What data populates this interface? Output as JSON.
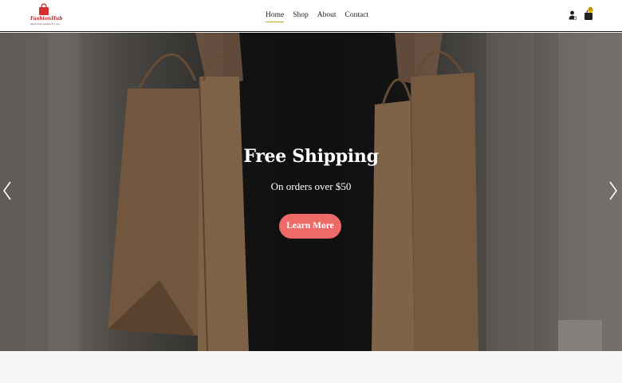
{
  "header": {
    "logo": {
      "name": "FashionHub",
      "tagline": "Style that speaks for you"
    },
    "nav": [
      {
        "label": "Home",
        "active": true
      },
      {
        "label": "Shop",
        "active": false
      },
      {
        "label": "About",
        "active": false
      },
      {
        "label": "Contact",
        "active": false
      }
    ],
    "icons": {
      "user": "user-icon",
      "cart": "shopping-bag-icon"
    },
    "cart_count": "0"
  },
  "hero": {
    "title": "Free Shipping",
    "subtitle": "On orders over $50",
    "button_label": "Learn More",
    "prev_arrow": "chevron-left-icon",
    "next_arrow": "chevron-right-icon"
  },
  "colors": {
    "accent_button": "#ee6a68",
    "nav_underline": "#c9a227",
    "logo_red": "#c62828",
    "cart_badge": "#e8b40c"
  }
}
